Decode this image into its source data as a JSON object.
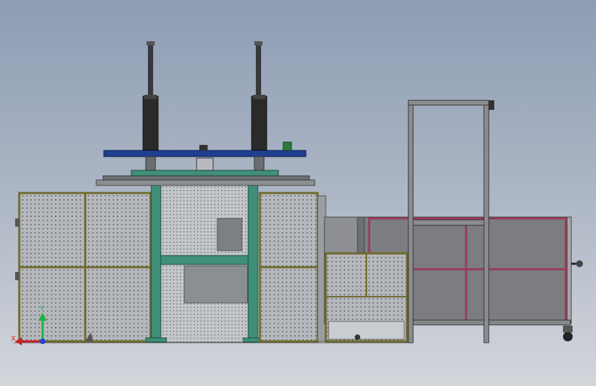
{
  "viewport": {
    "background_top": "#8e9db4",
    "background_bottom": "#d3d5db"
  },
  "colors": {
    "guard_frame": "#6f6a2a",
    "guard_mesh": "#a8abb0",
    "steel_green": "#3f8f7a",
    "platen_blue": "#1f3f8f",
    "cylinder": "#2a2a2a",
    "gray_frame": "#77787a",
    "cart_frame": "#9a3a5a"
  },
  "triad": {
    "x_label": "X",
    "y_label": "Y",
    "x_color": "#d02020",
    "y_color": "#20b040",
    "z_color": "#2040d0"
  }
}
